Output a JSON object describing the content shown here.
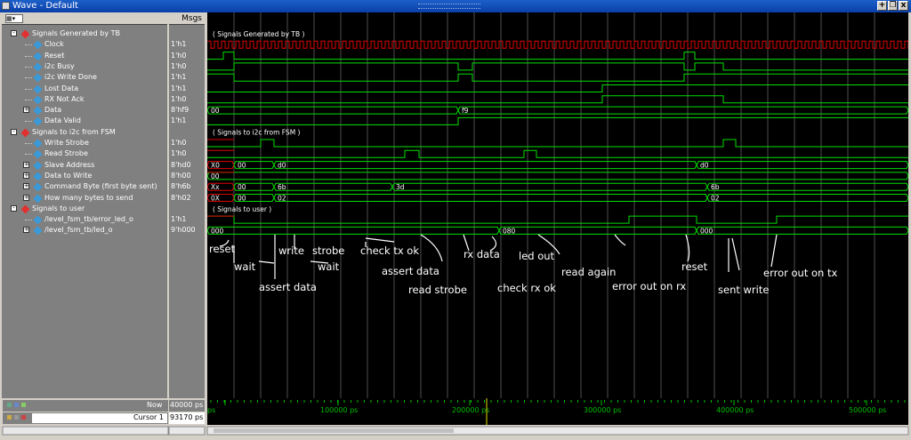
{
  "window": {
    "title": "Wave - Default",
    "buttons": [
      "+",
      "❐",
      "x"
    ]
  },
  "header": {
    "msgs": "Msgs"
  },
  "signals": [
    {
      "name": "Signals Generated by TB",
      "value": "",
      "group": true,
      "expand": "-"
    },
    {
      "name": "Clock",
      "value": "1'h1",
      "indent": 2
    },
    {
      "name": "Reset",
      "value": "1'h0",
      "indent": 2
    },
    {
      "name": "i2c Busy",
      "value": "1'h0",
      "indent": 2
    },
    {
      "name": "i2c Write Done",
      "value": "1'h1",
      "indent": 2
    },
    {
      "name": "Lost Data",
      "value": "1'h1",
      "indent": 2
    },
    {
      "name": "RX Not Ack",
      "value": "1'h0",
      "indent": 2
    },
    {
      "name": "Data",
      "value": "8'hf9",
      "indent": 2,
      "expand": "+"
    },
    {
      "name": "Data Valid",
      "value": "1'h1",
      "indent": 2
    },
    {
      "name": "Signals to i2c from FSM",
      "value": "",
      "group": true,
      "expand": "-"
    },
    {
      "name": "Write Strobe",
      "value": "1'h0",
      "indent": 2
    },
    {
      "name": "Read Strobe",
      "value": "1'h0",
      "indent": 2
    },
    {
      "name": "Slave Address",
      "value": "8'hd0",
      "indent": 2,
      "expand": "+"
    },
    {
      "name": "Data to Write",
      "value": "8'h00",
      "indent": 2,
      "expand": "+"
    },
    {
      "name": "Command Byte (first byte sent)",
      "value": "8'h6b",
      "indent": 2,
      "expand": "+"
    },
    {
      "name": "How many bytes to send",
      "value": "8'h02",
      "indent": 2,
      "expand": "+"
    },
    {
      "name": "Signals to user",
      "value": "",
      "group": true,
      "expand": "-"
    },
    {
      "name": "/level_fsm_tb/error_led_o",
      "value": "1'h1",
      "indent": 2
    },
    {
      "name": "/level_fsm_tb/led_o",
      "value": "9'h000",
      "indent": 2,
      "expand": "+"
    }
  ],
  "group_labels": {
    "tb": "( Signals Generated by TB )",
    "fsm": "( Signals to i2c from FSM )",
    "user": "( Signals to user )"
  },
  "bus_labels": {
    "data": [
      "00",
      "f9"
    ],
    "slave": [
      "X0",
      "00",
      "d0",
      "d0"
    ],
    "dw": [
      "00"
    ],
    "cmd": [
      "Xx",
      "00",
      "6b",
      "3d",
      "6b"
    ],
    "bytes": [
      "0X",
      "00",
      "02",
      "02"
    ],
    "led": [
      "000",
      "080",
      "000"
    ]
  },
  "annotations": [
    "reset",
    "wait",
    "assert data",
    "write",
    "strobe",
    "wait",
    "check tx ok",
    "assert data",
    "read strobe",
    "rx data",
    "check rx ok",
    "led out",
    "read again",
    "error out on rx",
    "reset",
    "sent write",
    "error out on tx"
  ],
  "timeline": {
    "now_label": "Now",
    "now_value": "40000 ps",
    "cursor_label": "Cursor 1",
    "cursor_value": "93170 ps",
    "ticks": [
      "ps",
      "100000 ps",
      "200000 ps",
      "300000 ps",
      "400000 ps",
      "500000 ps"
    ]
  },
  "colors": {
    "wave": "#00e000",
    "clock": "#e00000",
    "group_icon": "#e03030",
    "signal_icon": "#3a9ad9",
    "tree_line": "#cccccc"
  }
}
